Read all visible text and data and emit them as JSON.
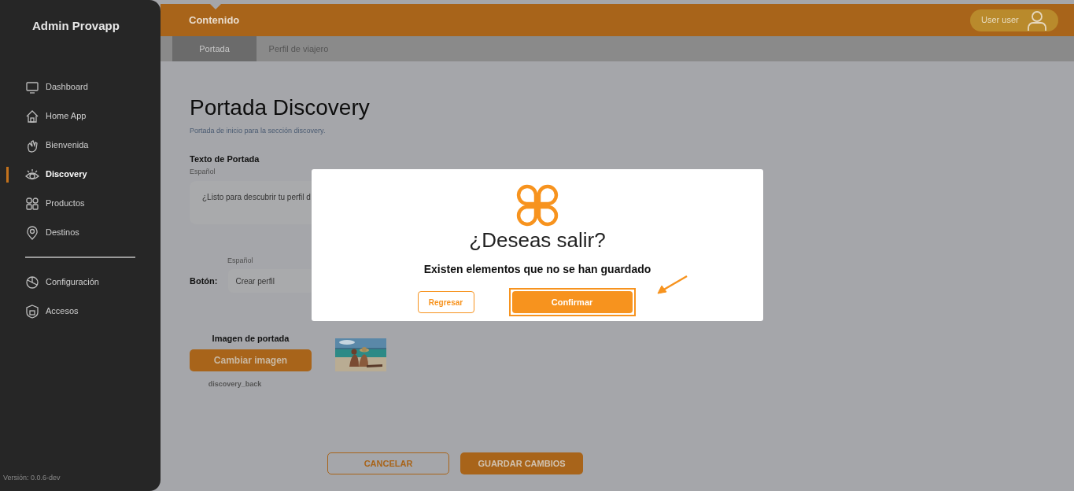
{
  "sidebar": {
    "title": "Admin Provapp",
    "items": [
      {
        "label": "Dashboard",
        "selected": false
      },
      {
        "label": "Home App",
        "selected": false
      },
      {
        "label": "Bienvenida",
        "selected": false
      },
      {
        "label": "Discovery",
        "selected": true
      },
      {
        "label": "Productos",
        "selected": false
      },
      {
        "label": "Destinos",
        "selected": false
      }
    ],
    "bottom_items": [
      {
        "label": "Configuración",
        "selected": false
      },
      {
        "label": "Accesos",
        "selected": false
      }
    ],
    "version": "Versión: 0.0.6-dev"
  },
  "header": {
    "section": "Contenido",
    "user": "User user"
  },
  "tabs": [
    {
      "label": "Portada",
      "selected": true
    },
    {
      "label": "Perfil de viajero",
      "selected": false
    }
  ],
  "page": {
    "title": "Portada Discovery",
    "subtitle": "Portada de inicio para la sección discovery.",
    "cover_text": {
      "label": "Texto de Portada",
      "lang": "Español",
      "value": "¿Listo para descubrir tu perfil d"
    },
    "button_field": {
      "label": "Botón:",
      "lang": "Español",
      "value": "Crear perfil"
    },
    "image": {
      "label": "Imagen de portada",
      "button": "Cambiar imagen",
      "filename": "discovery_back",
      "kind": "picture"
    },
    "actions": [
      "CANCELAR",
      "GUARDAR CAMBIOS"
    ]
  },
  "dialog": {
    "title": "¿Deseas salir?",
    "message": "Existen elementos que no se han guardado",
    "buttons": [
      "Regresar",
      "Confirmar"
    ]
  }
}
